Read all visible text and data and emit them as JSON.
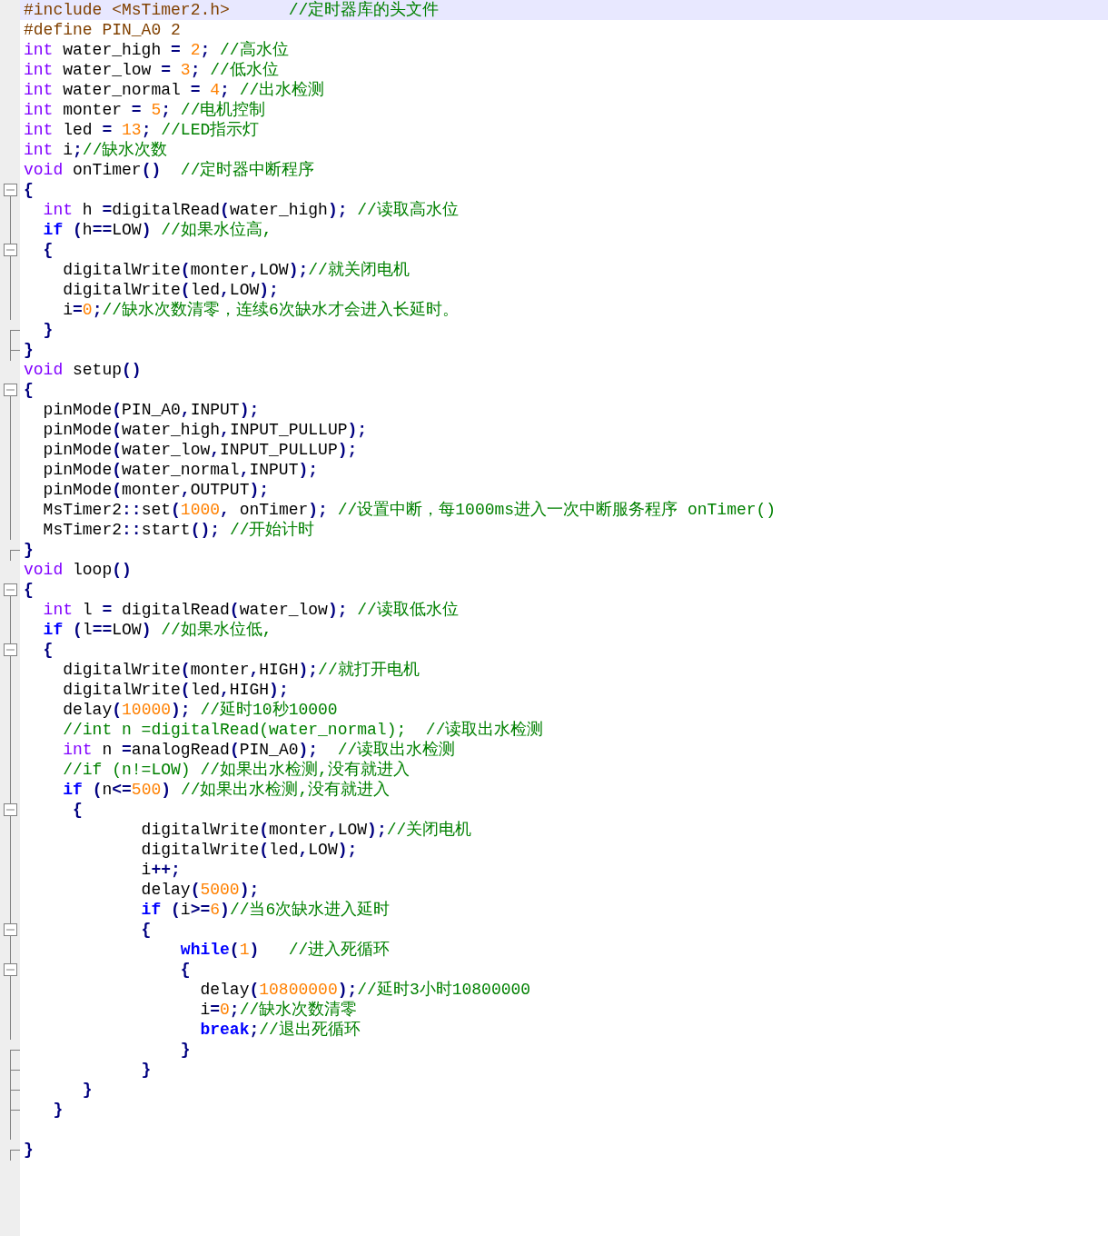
{
  "editor": {
    "lines": [
      {
        "kind": "none",
        "current": true,
        "tokens": [
          {
            "kind": "pre",
            "text": "#include <MsTimer2.h>      "
          },
          {
            "kind": "cmt",
            "text": "//定时器库的头文件"
          }
        ]
      },
      {
        "kind": "none",
        "current": false,
        "tokens": [
          {
            "kind": "pre",
            "text": "#define PIN_A0 2"
          }
        ]
      },
      {
        "kind": "none",
        "current": false,
        "tokens": [
          {
            "kind": "type",
            "text": "int"
          },
          {
            "kind": "txt",
            "text": " water_high "
          },
          {
            "kind": "op",
            "text": "= "
          },
          {
            "kind": "num",
            "text": "2"
          },
          {
            "kind": "op",
            "text": "; "
          },
          {
            "kind": "cmt",
            "text": "//高水位"
          }
        ]
      },
      {
        "kind": "none",
        "current": false,
        "tokens": [
          {
            "kind": "type",
            "text": "int"
          },
          {
            "kind": "txt",
            "text": " water_low "
          },
          {
            "kind": "op",
            "text": "= "
          },
          {
            "kind": "num",
            "text": "3"
          },
          {
            "kind": "op",
            "text": "; "
          },
          {
            "kind": "cmt",
            "text": "//低水位"
          }
        ]
      },
      {
        "kind": "none",
        "current": false,
        "tokens": [
          {
            "kind": "type",
            "text": "int"
          },
          {
            "kind": "txt",
            "text": " water_normal "
          },
          {
            "kind": "op",
            "text": "= "
          },
          {
            "kind": "num",
            "text": "4"
          },
          {
            "kind": "op",
            "text": "; "
          },
          {
            "kind": "cmt",
            "text": "//出水检测"
          }
        ]
      },
      {
        "kind": "none",
        "current": false,
        "tokens": [
          {
            "kind": "type",
            "text": "int"
          },
          {
            "kind": "txt",
            "text": " monter "
          },
          {
            "kind": "op",
            "text": "= "
          },
          {
            "kind": "num",
            "text": "5"
          },
          {
            "kind": "op",
            "text": "; "
          },
          {
            "kind": "cmt",
            "text": "//电机控制"
          }
        ]
      },
      {
        "kind": "none",
        "current": false,
        "tokens": [
          {
            "kind": "type",
            "text": "int"
          },
          {
            "kind": "txt",
            "text": " led "
          },
          {
            "kind": "op",
            "text": "= "
          },
          {
            "kind": "num",
            "text": "13"
          },
          {
            "kind": "op",
            "text": "; "
          },
          {
            "kind": "cmt",
            "text": "//LED指示灯"
          }
        ]
      },
      {
        "kind": "none",
        "current": false,
        "tokens": [
          {
            "kind": "type",
            "text": "int"
          },
          {
            "kind": "txt",
            "text": " i"
          },
          {
            "kind": "op",
            "text": ";"
          },
          {
            "kind": "cmt",
            "text": "//缺水次数"
          }
        ]
      },
      {
        "kind": "none",
        "current": false,
        "tokens": [
          {
            "kind": "type",
            "text": "void"
          },
          {
            "kind": "txt",
            "text": " onTimer"
          },
          {
            "kind": "op",
            "text": "()  "
          },
          {
            "kind": "cmt",
            "text": "//定时器中断程序"
          }
        ]
      },
      {
        "kind": "open",
        "current": false,
        "tokens": [
          {
            "kind": "op",
            "text": "{"
          }
        ]
      },
      {
        "kind": "line",
        "current": false,
        "tokens": [
          {
            "kind": "type",
            "text": "  int"
          },
          {
            "kind": "txt",
            "text": " h "
          },
          {
            "kind": "op",
            "text": "="
          },
          {
            "kind": "txt",
            "text": "digitalRead"
          },
          {
            "kind": "op",
            "text": "("
          },
          {
            "kind": "txt",
            "text": "water_high"
          },
          {
            "kind": "op",
            "text": "); "
          },
          {
            "kind": "cmt",
            "text": "//读取高水位"
          }
        ]
      },
      {
        "kind": "line",
        "current": false,
        "tokens": [
          {
            "kind": "kw",
            "text": "  if "
          },
          {
            "kind": "op",
            "text": "("
          },
          {
            "kind": "txt",
            "text": "h"
          },
          {
            "kind": "op",
            "text": "=="
          },
          {
            "kind": "txt",
            "text": "LOW"
          },
          {
            "kind": "op",
            "text": ") "
          },
          {
            "kind": "cmt",
            "text": "//如果水位高,"
          }
        ]
      },
      {
        "kind": "open-nested",
        "current": false,
        "tokens": [
          {
            "kind": "op",
            "text": "  {"
          }
        ]
      },
      {
        "kind": "line",
        "current": false,
        "tokens": [
          {
            "kind": "txt",
            "text": "    digitalWrite"
          },
          {
            "kind": "op",
            "text": "("
          },
          {
            "kind": "txt",
            "text": "monter"
          },
          {
            "kind": "op",
            "text": ","
          },
          {
            "kind": "txt",
            "text": "LOW"
          },
          {
            "kind": "op",
            "text": ");"
          },
          {
            "kind": "cmt",
            "text": "//就关闭电机"
          }
        ]
      },
      {
        "kind": "line",
        "current": false,
        "tokens": [
          {
            "kind": "txt",
            "text": "    digitalWrite"
          },
          {
            "kind": "op",
            "text": "("
          },
          {
            "kind": "txt",
            "text": "led"
          },
          {
            "kind": "op",
            "text": ","
          },
          {
            "kind": "txt",
            "text": "LOW"
          },
          {
            "kind": "op",
            "text": ");"
          }
        ]
      },
      {
        "kind": "line",
        "current": false,
        "tokens": [
          {
            "kind": "txt",
            "text": "    i"
          },
          {
            "kind": "op",
            "text": "="
          },
          {
            "kind": "num",
            "text": "0"
          },
          {
            "kind": "op",
            "text": ";"
          },
          {
            "kind": "cmt",
            "text": "//缺水次数清零，连续6次缺水才会进入长延时。"
          }
        ]
      },
      {
        "kind": "tick",
        "current": false,
        "tokens": [
          {
            "kind": "op",
            "text": "  }"
          }
        ]
      },
      {
        "kind": "end",
        "current": false,
        "tokens": [
          {
            "kind": "op",
            "text": "}"
          }
        ]
      },
      {
        "kind": "none",
        "current": false,
        "tokens": [
          {
            "kind": "type",
            "text": "void"
          },
          {
            "kind": "txt",
            "text": " setup"
          },
          {
            "kind": "op",
            "text": "()"
          }
        ]
      },
      {
        "kind": "open",
        "current": false,
        "tokens": [
          {
            "kind": "op",
            "text": "{"
          }
        ]
      },
      {
        "kind": "line",
        "current": false,
        "tokens": [
          {
            "kind": "txt",
            "text": "  pinMode"
          },
          {
            "kind": "op",
            "text": "("
          },
          {
            "kind": "txt",
            "text": "PIN_A0"
          },
          {
            "kind": "op",
            "text": ","
          },
          {
            "kind": "txt",
            "text": "INPUT"
          },
          {
            "kind": "op",
            "text": ");"
          }
        ]
      },
      {
        "kind": "line",
        "current": false,
        "tokens": [
          {
            "kind": "txt",
            "text": "  pinMode"
          },
          {
            "kind": "op",
            "text": "("
          },
          {
            "kind": "txt",
            "text": "water_high"
          },
          {
            "kind": "op",
            "text": ","
          },
          {
            "kind": "txt",
            "text": "INPUT_PULLUP"
          },
          {
            "kind": "op",
            "text": ");"
          }
        ]
      },
      {
        "kind": "line",
        "current": false,
        "tokens": [
          {
            "kind": "txt",
            "text": "  pinMode"
          },
          {
            "kind": "op",
            "text": "("
          },
          {
            "kind": "txt",
            "text": "water_low"
          },
          {
            "kind": "op",
            "text": ","
          },
          {
            "kind": "txt",
            "text": "INPUT_PULLUP"
          },
          {
            "kind": "op",
            "text": ");"
          }
        ]
      },
      {
        "kind": "line",
        "current": false,
        "tokens": [
          {
            "kind": "txt",
            "text": "  pinMode"
          },
          {
            "kind": "op",
            "text": "("
          },
          {
            "kind": "txt",
            "text": "water_normal"
          },
          {
            "kind": "op",
            "text": ","
          },
          {
            "kind": "txt",
            "text": "INPUT"
          },
          {
            "kind": "op",
            "text": ");"
          }
        ]
      },
      {
        "kind": "line",
        "current": false,
        "tokens": [
          {
            "kind": "txt",
            "text": "  pinMode"
          },
          {
            "kind": "op",
            "text": "("
          },
          {
            "kind": "txt",
            "text": "monter"
          },
          {
            "kind": "op",
            "text": ","
          },
          {
            "kind": "txt",
            "text": "OUTPUT"
          },
          {
            "kind": "op",
            "text": ");"
          }
        ]
      },
      {
        "kind": "line",
        "current": false,
        "tokens": [
          {
            "kind": "txt",
            "text": "  MsTimer2"
          },
          {
            "kind": "op",
            "text": "::"
          },
          {
            "kind": "txt",
            "text": "set"
          },
          {
            "kind": "op",
            "text": "("
          },
          {
            "kind": "num",
            "text": "1000"
          },
          {
            "kind": "op",
            "text": ","
          },
          {
            "kind": "txt",
            "text": " onTimer"
          },
          {
            "kind": "op",
            "text": "); "
          },
          {
            "kind": "cmt",
            "text": "//设置中断，每1000ms进入一次中断服务程序 onTimer()"
          }
        ]
      },
      {
        "kind": "line",
        "current": false,
        "tokens": [
          {
            "kind": "txt",
            "text": "  MsTimer2"
          },
          {
            "kind": "op",
            "text": "::"
          },
          {
            "kind": "txt",
            "text": "start"
          },
          {
            "kind": "op",
            "text": "(); "
          },
          {
            "kind": "cmt",
            "text": "//开始计时"
          }
        ]
      },
      {
        "kind": "end",
        "current": false,
        "tokens": [
          {
            "kind": "op",
            "text": "}"
          }
        ]
      },
      {
        "kind": "none",
        "current": false,
        "tokens": [
          {
            "kind": "type",
            "text": "void"
          },
          {
            "kind": "txt",
            "text": " loop"
          },
          {
            "kind": "op",
            "text": "()"
          }
        ]
      },
      {
        "kind": "open",
        "current": false,
        "tokens": [
          {
            "kind": "op",
            "text": "{"
          }
        ]
      },
      {
        "kind": "line",
        "current": false,
        "tokens": [
          {
            "kind": "type",
            "text": "  int"
          },
          {
            "kind": "txt",
            "text": " l "
          },
          {
            "kind": "op",
            "text": "="
          },
          {
            "kind": "txt",
            "text": " digitalRead"
          },
          {
            "kind": "op",
            "text": "("
          },
          {
            "kind": "txt",
            "text": "water_low"
          },
          {
            "kind": "op",
            "text": "); "
          },
          {
            "kind": "cmt",
            "text": "//读取低水位"
          }
        ]
      },
      {
        "kind": "line",
        "current": false,
        "tokens": [
          {
            "kind": "kw",
            "text": "  if "
          },
          {
            "kind": "op",
            "text": "("
          },
          {
            "kind": "txt",
            "text": "l"
          },
          {
            "kind": "op",
            "text": "=="
          },
          {
            "kind": "txt",
            "text": "LOW"
          },
          {
            "kind": "op",
            "text": ") "
          },
          {
            "kind": "cmt",
            "text": "//如果水位低,"
          }
        ]
      },
      {
        "kind": "open-nested",
        "current": false,
        "tokens": [
          {
            "kind": "op",
            "text": "  {"
          }
        ]
      },
      {
        "kind": "line",
        "current": false,
        "tokens": [
          {
            "kind": "txt",
            "text": "    digitalWrite"
          },
          {
            "kind": "op",
            "text": "("
          },
          {
            "kind": "txt",
            "text": "monter"
          },
          {
            "kind": "op",
            "text": ","
          },
          {
            "kind": "txt",
            "text": "HIGH"
          },
          {
            "kind": "op",
            "text": ");"
          },
          {
            "kind": "cmt",
            "text": "//就打开电机"
          }
        ]
      },
      {
        "kind": "line",
        "current": false,
        "tokens": [
          {
            "kind": "txt",
            "text": "    digitalWrite"
          },
          {
            "kind": "op",
            "text": "("
          },
          {
            "kind": "txt",
            "text": "led"
          },
          {
            "kind": "op",
            "text": ","
          },
          {
            "kind": "txt",
            "text": "HIGH"
          },
          {
            "kind": "op",
            "text": ");"
          }
        ]
      },
      {
        "kind": "line",
        "current": false,
        "tokens": [
          {
            "kind": "txt",
            "text": "    delay"
          },
          {
            "kind": "op",
            "text": "("
          },
          {
            "kind": "num",
            "text": "10000"
          },
          {
            "kind": "op",
            "text": "); "
          },
          {
            "kind": "cmt",
            "text": "//延时10秒10000"
          }
        ]
      },
      {
        "kind": "line",
        "current": false,
        "tokens": [
          {
            "kind": "cmt",
            "text": "    //int n =digitalRead(water_normal);  //读取出水检测"
          }
        ]
      },
      {
        "kind": "line",
        "current": false,
        "tokens": [
          {
            "kind": "type",
            "text": "    int"
          },
          {
            "kind": "txt",
            "text": " n "
          },
          {
            "kind": "op",
            "text": "="
          },
          {
            "kind": "txt",
            "text": "analogRead"
          },
          {
            "kind": "op",
            "text": "("
          },
          {
            "kind": "txt",
            "text": "PIN_A0"
          },
          {
            "kind": "op",
            "text": ");  "
          },
          {
            "kind": "cmt",
            "text": "//读取出水检测"
          }
        ]
      },
      {
        "kind": "line",
        "current": false,
        "tokens": [
          {
            "kind": "cmt",
            "text": "    //if (n!=LOW) //如果出水检测,没有就进入"
          }
        ]
      },
      {
        "kind": "line",
        "current": false,
        "tokens": [
          {
            "kind": "kw",
            "text": "    if "
          },
          {
            "kind": "op",
            "text": "("
          },
          {
            "kind": "txt",
            "text": "n"
          },
          {
            "kind": "op",
            "text": "<="
          },
          {
            "kind": "num",
            "text": "500"
          },
          {
            "kind": "op",
            "text": ") "
          },
          {
            "kind": "cmt",
            "text": "//如果出水检测,没有就进入"
          }
        ]
      },
      {
        "kind": "open-nested",
        "current": false,
        "tokens": [
          {
            "kind": "op",
            "text": "     {"
          }
        ]
      },
      {
        "kind": "line",
        "current": false,
        "tokens": [
          {
            "kind": "txt",
            "text": "            digitalWrite"
          },
          {
            "kind": "op",
            "text": "("
          },
          {
            "kind": "txt",
            "text": "monter"
          },
          {
            "kind": "op",
            "text": ","
          },
          {
            "kind": "txt",
            "text": "LOW"
          },
          {
            "kind": "op",
            "text": ");"
          },
          {
            "kind": "cmt",
            "text": "//关闭电机"
          }
        ]
      },
      {
        "kind": "line",
        "current": false,
        "tokens": [
          {
            "kind": "txt",
            "text": "            digitalWrite"
          },
          {
            "kind": "op",
            "text": "("
          },
          {
            "kind": "txt",
            "text": "led"
          },
          {
            "kind": "op",
            "text": ","
          },
          {
            "kind": "txt",
            "text": "LOW"
          },
          {
            "kind": "op",
            "text": ");"
          }
        ]
      },
      {
        "kind": "line",
        "current": false,
        "tokens": [
          {
            "kind": "txt",
            "text": "            i"
          },
          {
            "kind": "op",
            "text": "++;"
          }
        ]
      },
      {
        "kind": "line",
        "current": false,
        "tokens": [
          {
            "kind": "txt",
            "text": "            delay"
          },
          {
            "kind": "op",
            "text": "("
          },
          {
            "kind": "num",
            "text": "5000"
          },
          {
            "kind": "op",
            "text": ");"
          }
        ]
      },
      {
        "kind": "line",
        "current": false,
        "tokens": [
          {
            "kind": "kw",
            "text": "            if "
          },
          {
            "kind": "op",
            "text": "("
          },
          {
            "kind": "txt",
            "text": "i"
          },
          {
            "kind": "op",
            "text": ">="
          },
          {
            "kind": "num",
            "text": "6"
          },
          {
            "kind": "op",
            "text": ")"
          },
          {
            "kind": "cmt",
            "text": "//当6次缺水进入延时"
          }
        ]
      },
      {
        "kind": "open-nested",
        "current": false,
        "tokens": [
          {
            "kind": "op",
            "text": "            {"
          }
        ]
      },
      {
        "kind": "line",
        "current": false,
        "tokens": [
          {
            "kind": "kw",
            "text": "                while"
          },
          {
            "kind": "op",
            "text": "("
          },
          {
            "kind": "num",
            "text": "1"
          },
          {
            "kind": "op",
            "text": ")   "
          },
          {
            "kind": "cmt",
            "text": "//进入死循环"
          }
        ]
      },
      {
        "kind": "open-nested",
        "current": false,
        "tokens": [
          {
            "kind": "op",
            "text": "                {"
          }
        ]
      },
      {
        "kind": "line",
        "current": false,
        "tokens": [
          {
            "kind": "txt",
            "text": "                  delay"
          },
          {
            "kind": "op",
            "text": "("
          },
          {
            "kind": "num",
            "text": "10800000"
          },
          {
            "kind": "op",
            "text": ");"
          },
          {
            "kind": "cmt",
            "text": "//延时3小时10800000"
          }
        ]
      },
      {
        "kind": "line",
        "current": false,
        "tokens": [
          {
            "kind": "txt",
            "text": "                  i"
          },
          {
            "kind": "op",
            "text": "="
          },
          {
            "kind": "num",
            "text": "0"
          },
          {
            "kind": "op",
            "text": ";"
          },
          {
            "kind": "cmt",
            "text": "//缺水次数清零"
          }
        ]
      },
      {
        "kind": "line",
        "current": false,
        "tokens": [
          {
            "kind": "kw",
            "text": "                  break"
          },
          {
            "kind": "op",
            "text": ";"
          },
          {
            "kind": "cmt",
            "text": "//退出死循环"
          }
        ]
      },
      {
        "kind": "tick",
        "current": false,
        "tokens": [
          {
            "kind": "op",
            "text": "                }"
          }
        ]
      },
      {
        "kind": "tick",
        "current": false,
        "tokens": [
          {
            "kind": "op",
            "text": "            }"
          }
        ]
      },
      {
        "kind": "tick",
        "current": false,
        "tokens": [
          {
            "kind": "op",
            "text": "      }"
          }
        ]
      },
      {
        "kind": "tick",
        "current": false,
        "tokens": [
          {
            "kind": "op",
            "text": "   }"
          }
        ]
      },
      {
        "kind": "line",
        "current": false
      },
      {
        "kind": "end",
        "current": false,
        "tokens": [
          {
            "kind": "op",
            "text": "}"
          }
        ]
      }
    ]
  }
}
